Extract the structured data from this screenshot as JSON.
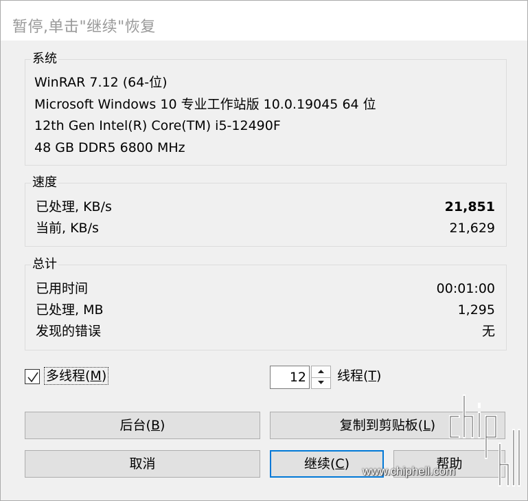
{
  "window": {
    "title": "暂停,单击\"继续\"恢复"
  },
  "system": {
    "group_title": "系统",
    "lines": [
      "WinRAR 7.12 (64-位)",
      "Microsoft Windows 10 专业工作站版 10.0.19045 64 位",
      "12th Gen Intel(R) Core(TM) i5-12490F",
      "48 GB DDR5 6800 MHz"
    ]
  },
  "speed": {
    "group_title": "速度",
    "rows": [
      {
        "label": "已处理, KB/s",
        "value": "21,851"
      },
      {
        "label": "当前, KB/s",
        "value": "21,629"
      }
    ]
  },
  "total": {
    "group_title": "总计",
    "rows": [
      {
        "label": "已用时间",
        "value": "00:01:00"
      },
      {
        "label": "已处理, MB",
        "value": "1,295"
      },
      {
        "label": "发现的错误",
        "value": "无"
      }
    ]
  },
  "options": {
    "multithread_label": "多线程(",
    "multithread_key": "M",
    "multithread_close": ")",
    "multithread_checked": true,
    "threads_value": "12",
    "threads_label": "线程(",
    "threads_key": "T",
    "threads_close": ")"
  },
  "buttons": {
    "background": {
      "label": "后台(",
      "key": "B",
      "close": ")"
    },
    "copy": {
      "label": "复制到剪贴板(",
      "key": "L",
      "close": ")"
    },
    "cancel": {
      "label": "取消"
    },
    "continue": {
      "label": "继续(",
      "key": "C",
      "close": ")"
    },
    "help": {
      "label": "帮助"
    }
  },
  "watermark": {
    "url": "www.chiphell.com",
    "logo_text": "chip hell"
  },
  "colors": {
    "accent_border": "#0078d7",
    "title_text": "#999999",
    "dialog_bg": "#f0f0f0",
    "button_bg": "#e1e1e1"
  }
}
